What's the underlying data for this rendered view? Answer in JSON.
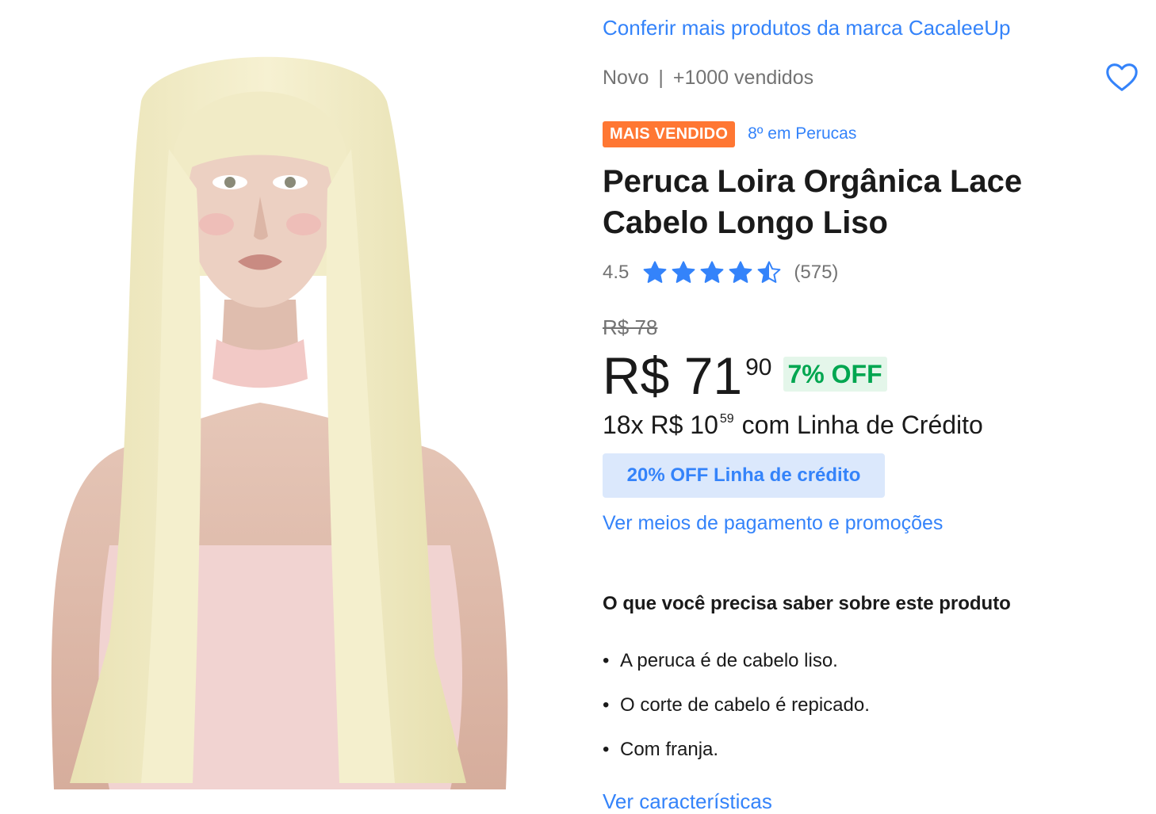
{
  "brand_link": "Conferir mais produtos da marca CacaleeUp",
  "condition": "Novo",
  "separator": "|",
  "sold": "+1000 vendidos",
  "badge": "MAIS VENDIDO",
  "rank": "8º em Perucas",
  "title": "Peruca Loira Orgânica Lace Cabelo Longo Liso",
  "rating": {
    "value": "4.5",
    "stars": 4.5,
    "max": 5,
    "count": "(575)"
  },
  "price": {
    "old": "R$ 78",
    "main": "R$ 71",
    "cents": "90",
    "discount": "7% OFF"
  },
  "installments": {
    "prefix": "18x R$ 10",
    "cents": "59",
    "suffix": "com Linha de Crédito"
  },
  "credit_banner": "20% OFF Linha de crédito",
  "payment_link": "Ver meios de pagamento e promoções",
  "section_title": "O que você precisa saber sobre este produto",
  "features": [
    "A peruca é de cabelo liso.",
    "O corte de cabelo é repicado.",
    "Com franja."
  ],
  "characteristics_link": "Ver características",
  "icons": {
    "favorite": "heart-icon",
    "rating": "star-icon"
  },
  "colors": {
    "link": "#3483fa",
    "badge": "#ff7733",
    "discount_text": "#00a650",
    "discount_bg": "#e4f6ea",
    "credit_bg": "#dbe8fc",
    "muted": "#737373"
  }
}
